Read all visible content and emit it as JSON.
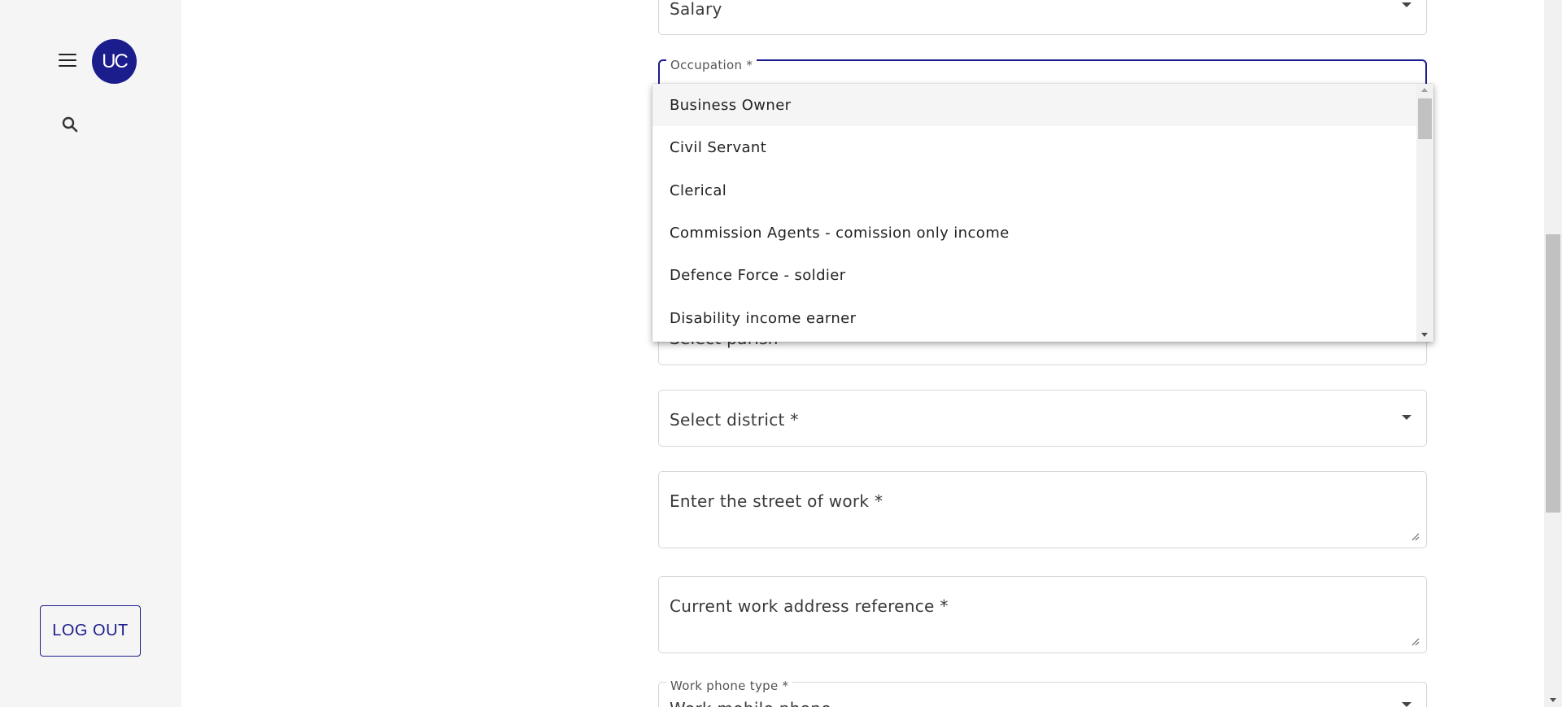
{
  "sidebar": {
    "avatar_text": "UC",
    "logout_label": "LOG OUT"
  },
  "form": {
    "income_type_value": "Salary",
    "occupation_label": "Occupation *",
    "parish_placeholder": "Select parish",
    "district_placeholder": "Select district *",
    "street_placeholder": "Enter the street of work *",
    "address_reference_placeholder": "Current work address reference *",
    "work_phone_type_label": "Work phone type *",
    "work_phone_type_value": "Work mobile phone"
  },
  "occupation_dropdown": {
    "options": [
      "Business Owner",
      "Civil Servant",
      "Clerical",
      "Commission Agents - comission only income",
      "Defence Force - soldier",
      "Disability income earner"
    ],
    "highlighted_index": 0
  },
  "colors": {
    "accent": "#1c1d8c",
    "sidebar_bg": "#f5f5f5",
    "border": "#d6d6d6"
  }
}
